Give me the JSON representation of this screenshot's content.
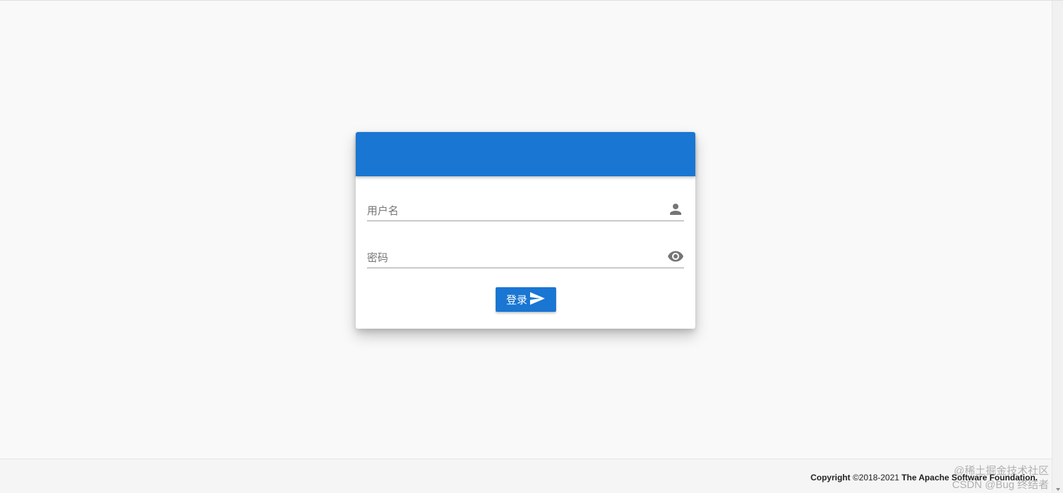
{
  "login": {
    "username_placeholder": "用户名",
    "password_placeholder": "密码",
    "submit_label": "登录"
  },
  "footer": {
    "copyright_label": "Copyright",
    "years": "©2018-2021",
    "organization": "The Apache Software Foundation."
  },
  "watermark": {
    "line1": "@稀土掘金技术社区",
    "line2": "CSDN @Bug 终结者"
  },
  "icons": {
    "username": "person-icon",
    "password": "eye-icon",
    "submit": "send-icon"
  },
  "colors": {
    "primary": "#1976d2",
    "background": "#f9f9f9",
    "card": "#ffffff",
    "label": "#757575"
  }
}
